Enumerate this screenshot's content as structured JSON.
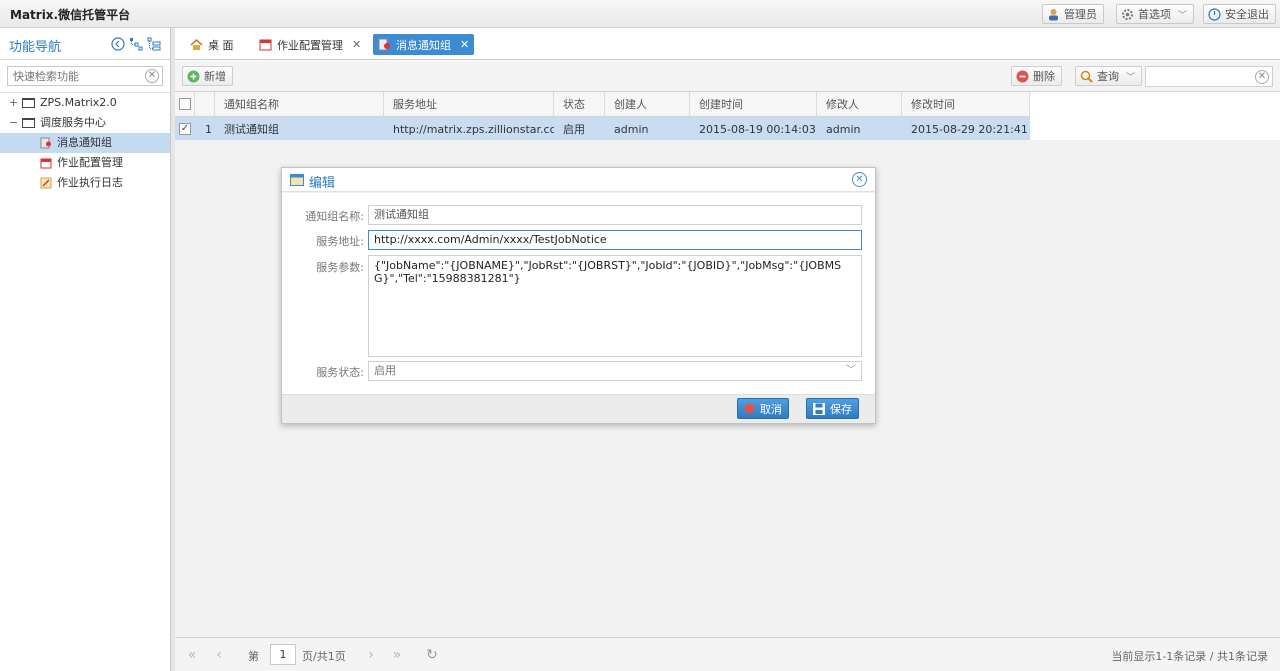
{
  "app": {
    "title": "Matrix.微信托管平台"
  },
  "topbar": {
    "admin_label": "管理员",
    "prefs_label": "首选项",
    "logout_label": "安全退出"
  },
  "sidebar": {
    "title": "功能导航",
    "search_placeholder": "快速检索功能",
    "tree": [
      {
        "label": "ZPS.Matrix2.0",
        "twist": "+"
      },
      {
        "label": "调度服务中心",
        "twist": "−"
      },
      {
        "label": "消息通知组"
      },
      {
        "label": "作业配置管理"
      },
      {
        "label": "作业执行日志"
      }
    ]
  },
  "tabs": [
    {
      "label": "桌 面"
    },
    {
      "label": "作业配置管理",
      "close": "✕"
    },
    {
      "label": "消息通知组",
      "close": "✕"
    }
  ],
  "toolbar": {
    "add_label": "新增",
    "delete_label": "删除",
    "query_label": "查询"
  },
  "grid": {
    "headers": [
      "通知组名称",
      "服务地址",
      "状态",
      "创建人",
      "创建时间",
      "修改人",
      "修改时间"
    ],
    "rows": [
      {
        "num": "1",
        "name": "测试通知组",
        "url": "http://matrix.zps.zillionstar.co...",
        "status": "启用",
        "creator": "admin",
        "created": "2015-08-19 00:14:03",
        "modifier": "admin",
        "modified": "2015-08-29 20:21:41"
      }
    ]
  },
  "pager": {
    "page_prefix": "第",
    "page_value": "1",
    "page_suffix": "页/共1页",
    "info": "当前显示1-1条记录 / 共1条记录"
  },
  "dialog": {
    "title": "编辑",
    "fields": {
      "name_label": "通知组名称:",
      "name_value": "测试通知组",
      "url_label": "服务地址:",
      "url_value": "http://xxxx.com/Admin/xxxx/TestJobNotice",
      "params_label": "服务参数:",
      "params_value": "{\"JobName\":\"{JOBNAME}\",\"JobRst\":\"{JOBRST}\",\"JobId\":\"{JOBID}\",\"JobMsg\":\"{JOBMSG}\",\"Tel\":\"15988381281\"}",
      "status_label": "服务状态:",
      "status_value": "启用"
    },
    "cancel_label": "取消",
    "save_label": "保存"
  }
}
